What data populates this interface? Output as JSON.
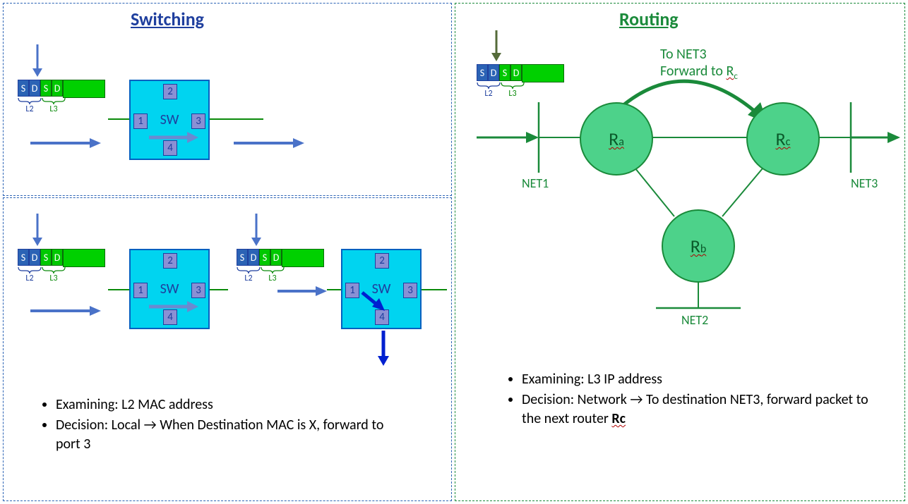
{
  "titles": {
    "switching": "Switching",
    "routing": "Routing"
  },
  "packet": {
    "s1": "S",
    "d1": "D",
    "s2": "S",
    "d2": "D",
    "l2": "L2",
    "l3": "L3"
  },
  "switch": {
    "label": "SW",
    "p1": "1",
    "p2": "2",
    "p3": "3",
    "p4": "4"
  },
  "routers": {
    "ra": "a",
    "rb": "b",
    "rc": "c",
    "prefix": "R"
  },
  "nets": {
    "n1": "NET1",
    "n2": "NET2",
    "n3": "NET3"
  },
  "fwd": {
    "line1": "To NET3",
    "line2_pre": "Forward to ",
    "line2_r": "R",
    "line2_sub": "c"
  },
  "bullets_switch": {
    "b1": "Examining: L2 MAC address",
    "b2": "Decision: Local → When Destination MAC is X, forward to port 3"
  },
  "bullets_route": {
    "b1": "Examining: L3 IP address",
    "b2_pre": "Decision: Network → To destination NET3, forward packet to the next router ",
    "b2_r": "Rc"
  }
}
